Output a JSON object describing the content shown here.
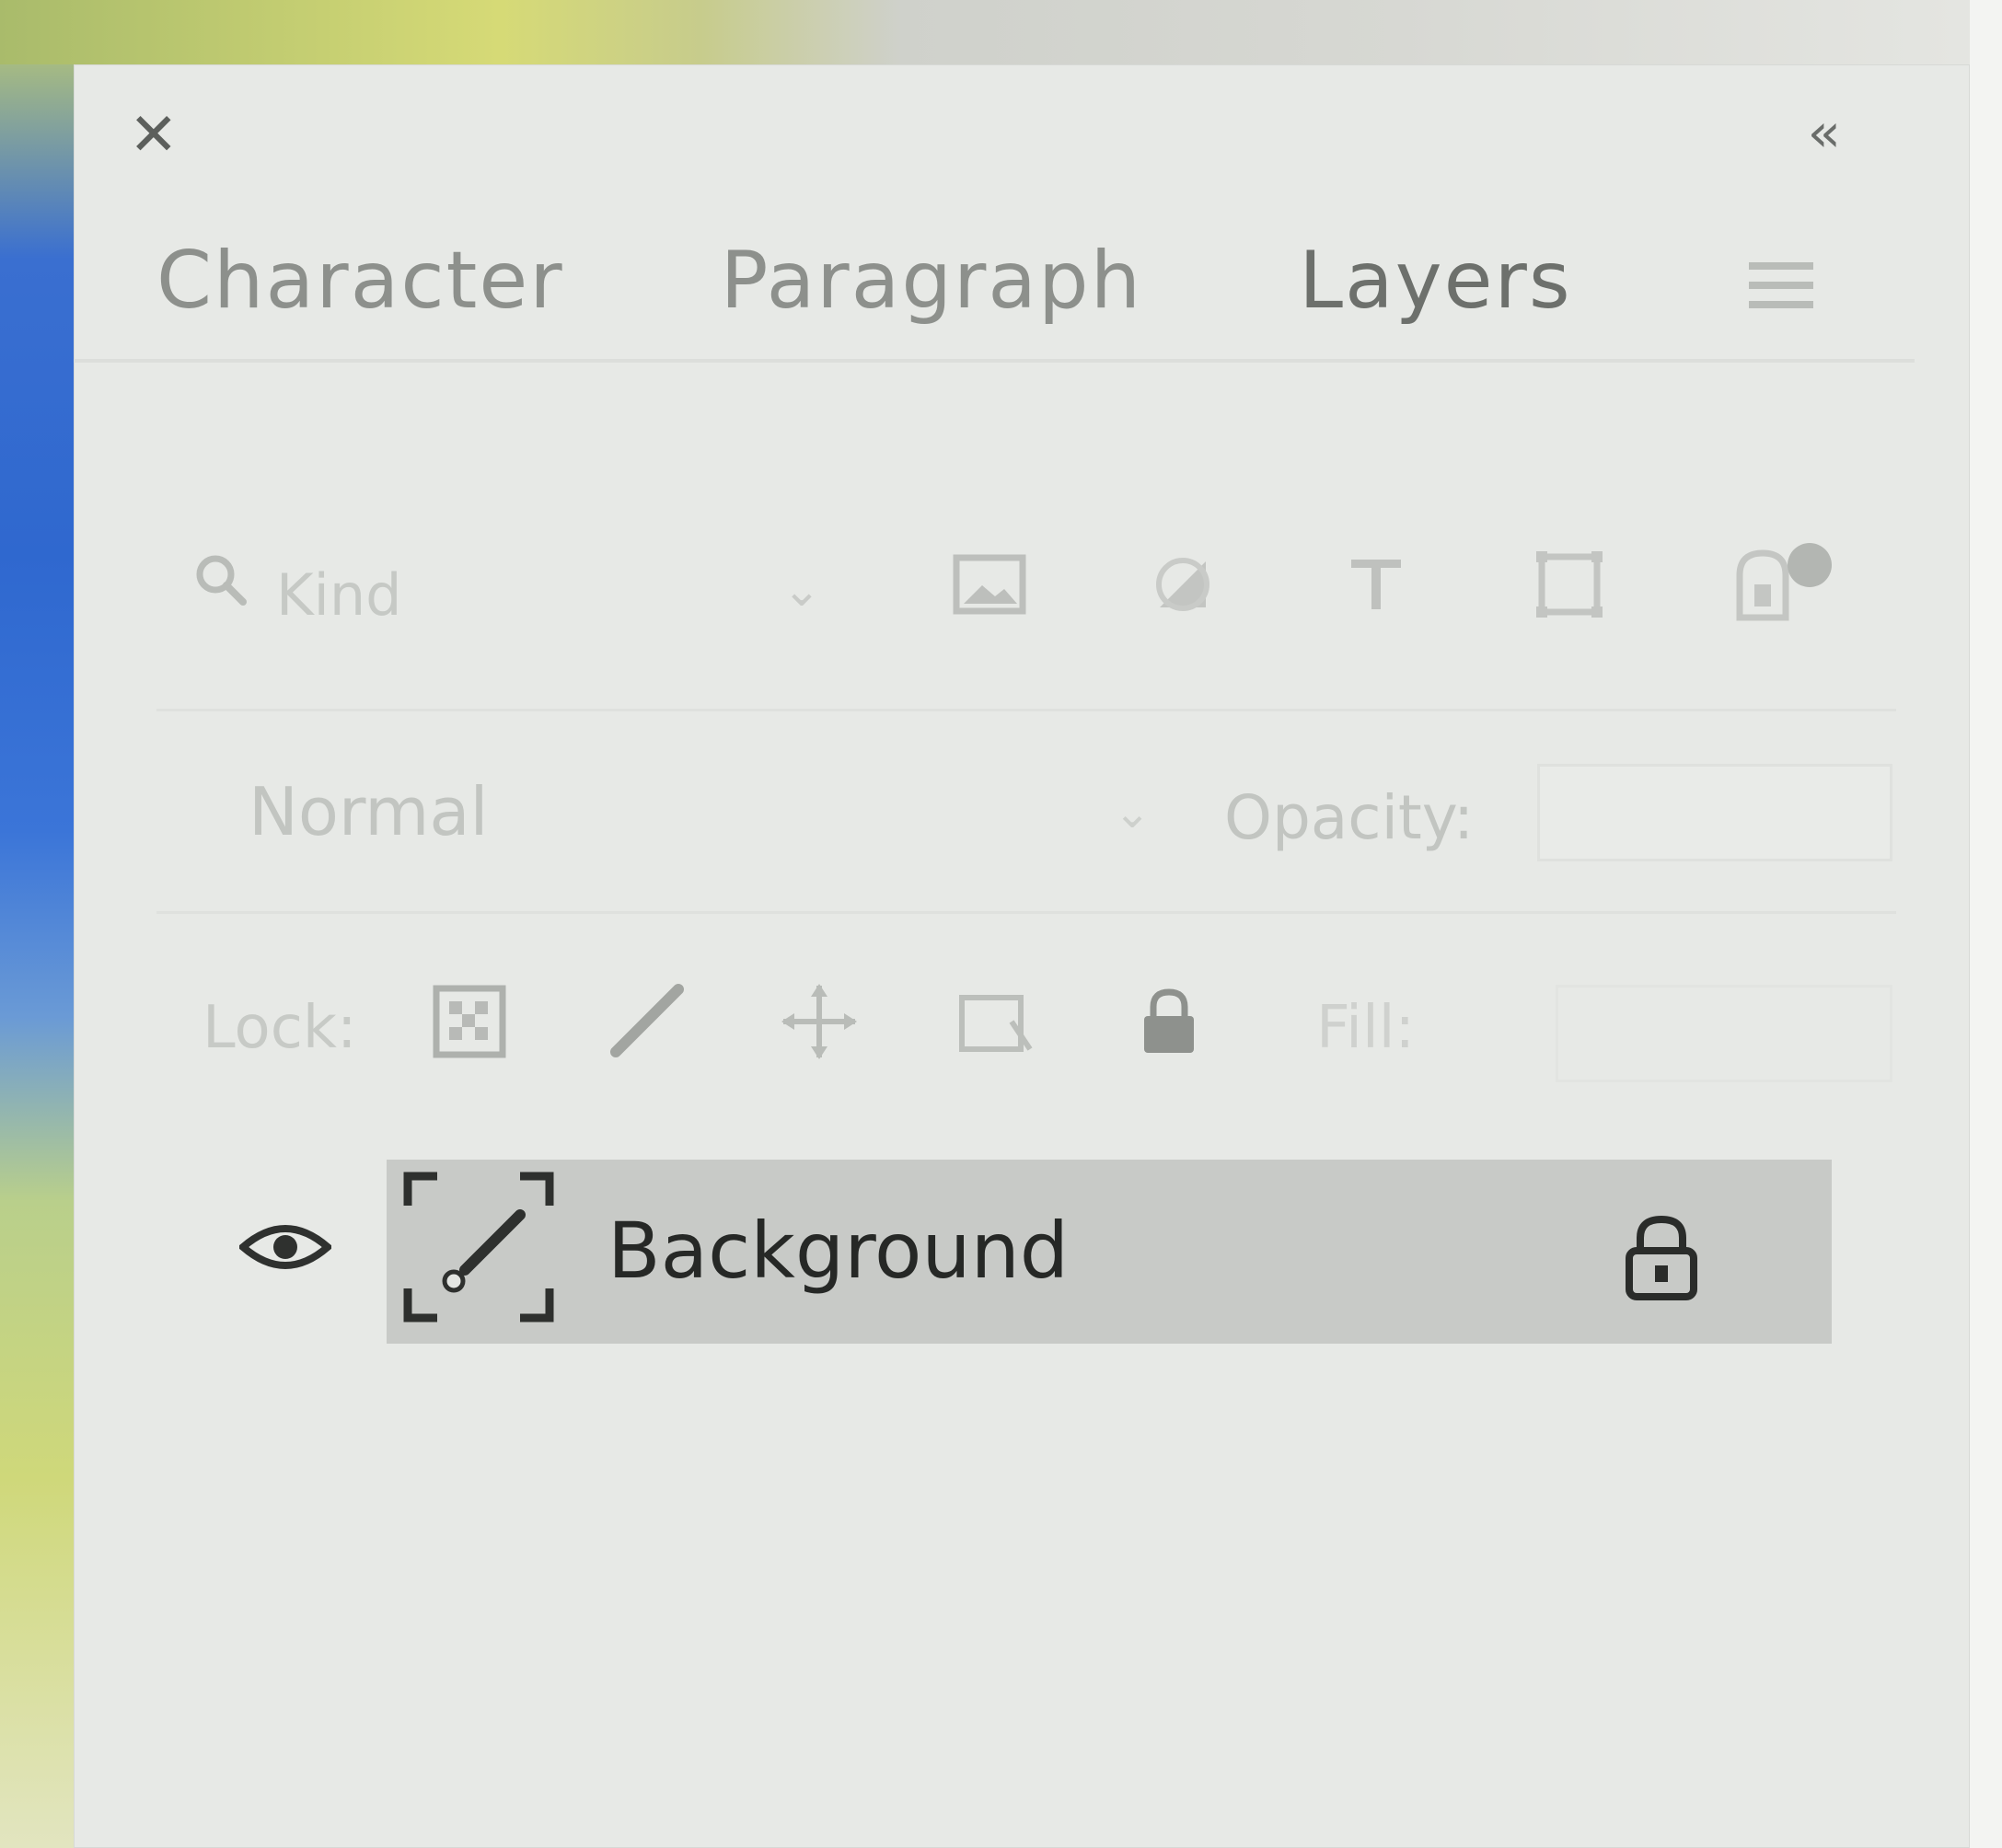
{
  "colors": {
    "panel_bg": "#e7e9e6",
    "selected_row": "#c8cac7",
    "tab_text": "#8d908c",
    "disabled_text": "#c4c7c3",
    "layer_text": "#262826"
  },
  "panel": {
    "close_icon": "close-icon",
    "collapse_icon": "double-chevron-left-icon",
    "menu_icon": "panel-menu-icon"
  },
  "tabs": [
    {
      "label": "Character"
    },
    {
      "label": "Paragraph"
    },
    {
      "label": "Layers",
      "active": true
    }
  ],
  "filter": {
    "search_icon": "search-icon",
    "kind_label": "Kind",
    "icons": [
      "image-filter-icon",
      "adjustment-filter-icon",
      "type-filter-icon",
      "shape-filter-icon",
      "smart-object-filter-icon"
    ],
    "toggle_icon": "filter-toggle-icon"
  },
  "blend": {
    "mode": "Normal",
    "opacity_label": "Opacity:"
  },
  "lock": {
    "label": "Lock:",
    "icons": [
      "lock-transparent-pixels-icon",
      "lock-image-pixels-icon",
      "lock-position-icon",
      "lock-artboard-icon",
      "lock-all-icon"
    ],
    "fill_label": "Fill:"
  },
  "layers": [
    {
      "name": "Background",
      "visible": true,
      "locked": true,
      "selected": true
    }
  ]
}
